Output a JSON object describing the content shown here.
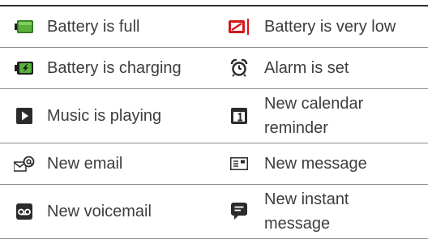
{
  "rows": [
    {
      "left": {
        "icon": "battery-full-icon",
        "label": "Battery is full"
      },
      "right": {
        "icon": "battery-very-low-icon",
        "label": "Battery is very low"
      }
    },
    {
      "left": {
        "icon": "battery-charging-icon",
        "label": "Battery is charging"
      },
      "right": {
        "icon": "alarm-clock-icon",
        "label": "Alarm is set"
      }
    },
    {
      "left": {
        "icon": "play-icon",
        "label": "Music is playing"
      },
      "right": {
        "icon": "calendar-icon",
        "label": "New calendar reminder"
      }
    },
    {
      "left": {
        "icon": "email-icon",
        "label": "New email"
      },
      "right": {
        "icon": "message-icon",
        "label": "New message"
      }
    },
    {
      "left": {
        "icon": "voicemail-icon",
        "label": "New voicemail"
      },
      "right": {
        "icon": "chat-bubble-icon",
        "label": "New instant message"
      }
    }
  ],
  "colors": {
    "battery_green": "#59b13a",
    "battery_red": "#d6171b",
    "icon_dark": "#2b2b2b",
    "text": "#3d3d3d",
    "rule": "#2f2f2f"
  }
}
